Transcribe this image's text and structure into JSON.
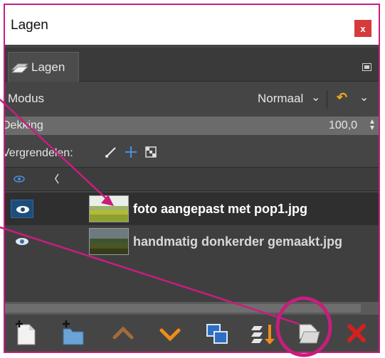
{
  "window": {
    "title": "Lagen",
    "close_label": "x"
  },
  "tabs": [
    {
      "label": "Lagen"
    }
  ],
  "mode": {
    "label": "Modus",
    "value": "Normaal"
  },
  "opacity": {
    "label": "Dekking",
    "value": "100,0"
  },
  "lock": {
    "label": "Vergrendelen:"
  },
  "layers": [
    {
      "name": "foto aangepast met pop1.jpg",
      "selected": true,
      "visible": true
    },
    {
      "name": "handmatig donkerder gemaakt.jpg",
      "selected": false,
      "visible": true
    }
  ],
  "toolbar": {
    "buttons": [
      {
        "icon": "new-layer-icon"
      },
      {
        "icon": "new-layer-group-icon"
      },
      {
        "icon": "raise-layer-icon"
      },
      {
        "icon": "lower-layer-icon"
      },
      {
        "icon": "duplicate-layer-icon"
      },
      {
        "icon": "anchor-merge-down-icon"
      },
      {
        "icon": "add-layer-mask-icon"
      },
      {
        "icon": "delete-layer-icon"
      }
    ]
  },
  "colors": {
    "annotation": "#c81d7e",
    "panel_bg": "#454545",
    "selected_row": "#2f2f2f",
    "eye_box": "#1e4d7a",
    "arrow_orange": "#f08c1a",
    "delete_red": "#d42020"
  }
}
